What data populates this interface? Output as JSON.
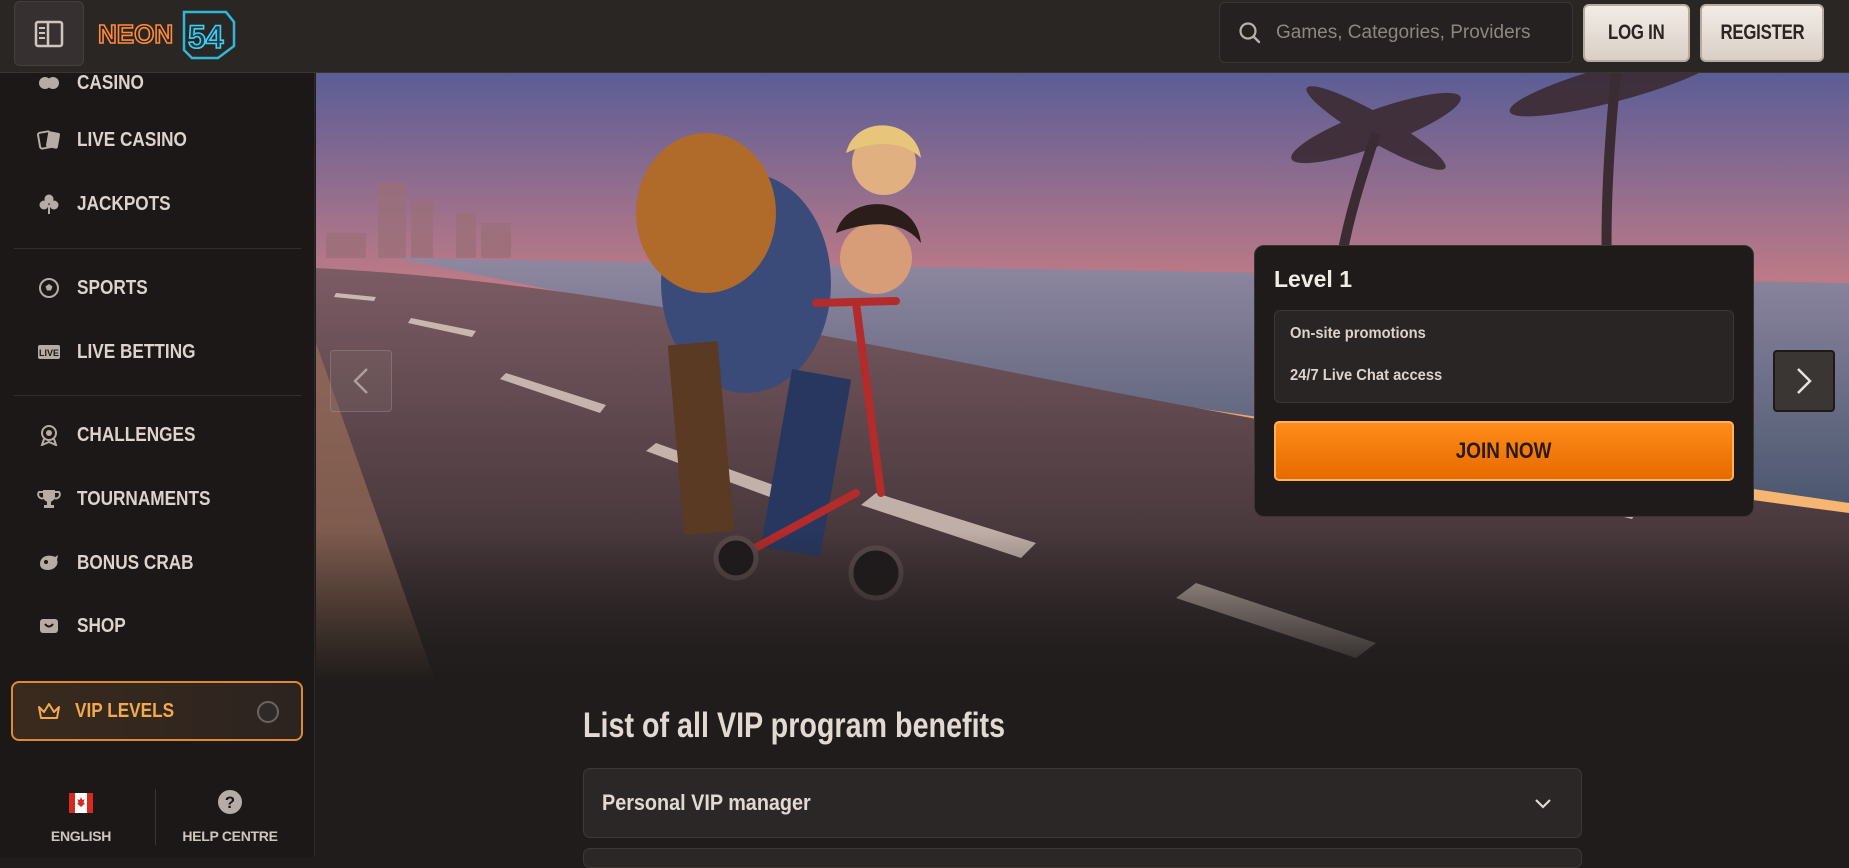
{
  "header": {
    "logo_text": "NEON54",
    "search_placeholder": "Games, Categories, Providers",
    "login_label": "LOG IN",
    "register_label": "REGISTER"
  },
  "sidebar": {
    "items": [
      {
        "label": "CASINO",
        "icon": "casino-icon"
      },
      {
        "label": "LIVE CASINO",
        "icon": "cards-icon"
      },
      {
        "label": "JACKPOTS",
        "icon": "clover-icon"
      },
      {
        "label": "SPORTS",
        "icon": "soccer-ball-icon"
      },
      {
        "label": "LIVE BETTING",
        "icon": "live-icon"
      },
      {
        "label": "CHALLENGES",
        "icon": "target-icon"
      },
      {
        "label": "TOURNAMENTS",
        "icon": "trophy-icon"
      },
      {
        "label": "BONUS CRAB",
        "icon": "crab-icon"
      },
      {
        "label": "SHOP",
        "icon": "shop-icon"
      }
    ],
    "vip_label": "VIP LEVELS",
    "language_label": "ENGLISH",
    "help_label": "HELP CENTRE"
  },
  "hero": {
    "level_title": "Level 1",
    "perks": [
      "On-site promotions",
      "24/7 Live Chat access"
    ],
    "join_label": "JOIN NOW"
  },
  "content": {
    "benefits_title": "List of all VIP program benefits",
    "accordion": [
      {
        "label": "Personal VIP manager"
      }
    ]
  },
  "colors": {
    "accent": "#f08a1c",
    "background": "#1f1c1b",
    "sidebar": "#1b1817"
  }
}
